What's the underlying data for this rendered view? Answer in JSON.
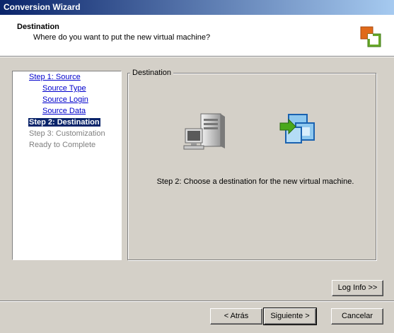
{
  "window": {
    "title": "Conversion Wizard"
  },
  "header": {
    "title": "Destination",
    "subtitle": "Where do you want to put the new virtual machine?"
  },
  "steps": [
    {
      "label": "Step 1: Source",
      "state": "link"
    },
    {
      "label": "Source Type",
      "state": "link"
    },
    {
      "label": "Source Login",
      "state": "link"
    },
    {
      "label": "Source Data",
      "state": "link"
    },
    {
      "label": "Step 2: Destination",
      "state": "current"
    },
    {
      "label": "Step 3: Customization",
      "state": "disabled"
    },
    {
      "label": "Ready to Complete",
      "state": "disabled"
    }
  ],
  "panel": {
    "group_label": "Destination",
    "message": "Step 2: Choose a destination for the new virtual machine."
  },
  "buttons": {
    "log_info": "Log Info >>",
    "back": "< Atrás",
    "next": "Siguiente >",
    "cancel": "Cancelar"
  },
  "colors": {
    "titlebar_start": "#0a246a",
    "titlebar_end": "#a6caf0",
    "current_step_bg": "#0a246a",
    "link": "#0000cc",
    "disabled": "#808080"
  }
}
